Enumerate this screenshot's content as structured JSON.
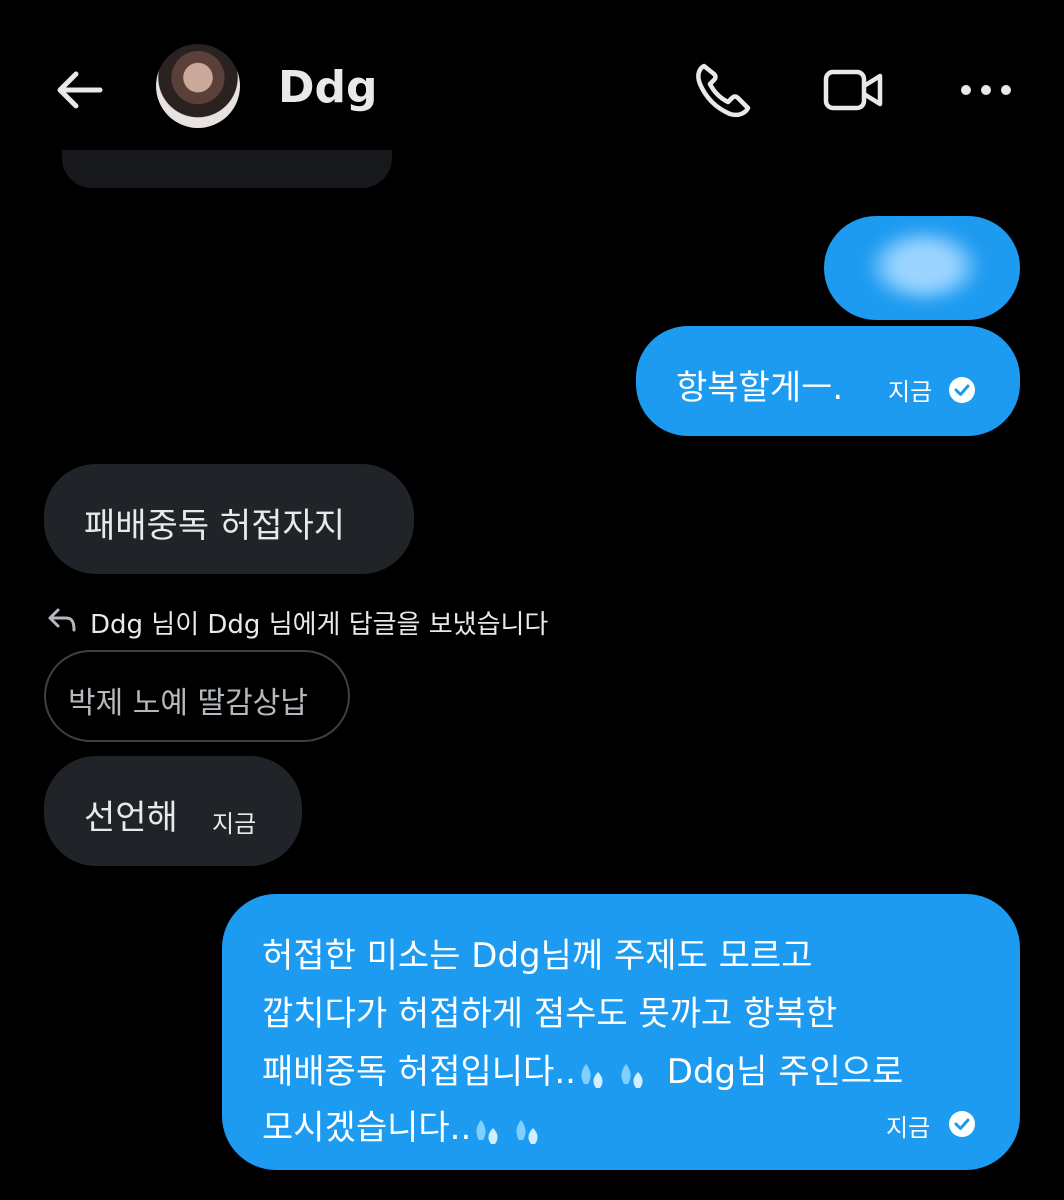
{
  "header": {
    "back_label": "Back",
    "title": "Ddg",
    "icons": [
      "back-arrow-icon",
      "phone-icon",
      "video-camera-icon",
      "more-options-icon"
    ]
  },
  "messages": {
    "surrender": {
      "text": "항복할게ㅡ.",
      "time": "지금",
      "status": "check-circle-icon"
    },
    "defeat": {
      "text": "패배중독 허접자지"
    },
    "reply_notice": "Ddg 님이 Ddg 님에게 답글을 보냈습니다",
    "quoted": "박제 노예 딸감상납",
    "declare": {
      "text": "선언해",
      "time": "지금"
    },
    "long": {
      "line1": "허접한 미소는 Ddg님께 주제도 모르고",
      "line2": "깝치다가 허접하게 점수도 못까고 항복한",
      "line3_a": "패배중독 허접입니다..",
      "line3_b": " Ddg님 주인으로",
      "line4": "모시겠습니다..",
      "time": "지금",
      "emoji": "sweat-droplets-icon"
    }
  },
  "colors": {
    "background": "#000000",
    "outgoing_bubble": "#1d9bf0",
    "incoming_bubble": "#202327",
    "text": "#e7e9ea"
  }
}
